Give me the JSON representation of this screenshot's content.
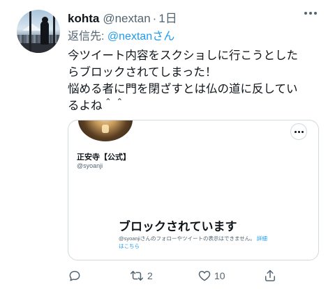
{
  "tweet": {
    "display_name": "kohta",
    "handle": "@nextan",
    "separator": "·",
    "time": "1日",
    "reply_to_prefix": "返信先: ",
    "reply_to_mention": "@nextan",
    "reply_to_suffix": "さん",
    "body_lines": [
      "今ツイート内容をスクショしに行こうとした",
      "らブロックされてしまった！",
      "悩める者に門を閉ざすとは仏の道に反してい",
      "るよね＾＾"
    ]
  },
  "card": {
    "account_name": "正安寺【公式】",
    "account_handle": "@syoanji",
    "blocked_title": "ブロックされています",
    "blocked_desc": "@syoanjiさんのフォローやツイートの表示はできません。",
    "blocked_link": "詳細はこちら"
  },
  "actions": {
    "reply_count": "",
    "retweet_count": "2",
    "like_count": "10"
  },
  "colors": {
    "accent": "#1d9bf0",
    "text_primary": "#0f1419",
    "text_secondary": "#536471",
    "border": "#cfd9de"
  },
  "icons": [
    "reply-icon",
    "retweet-icon",
    "like-icon",
    "share-icon",
    "more-icon"
  ]
}
